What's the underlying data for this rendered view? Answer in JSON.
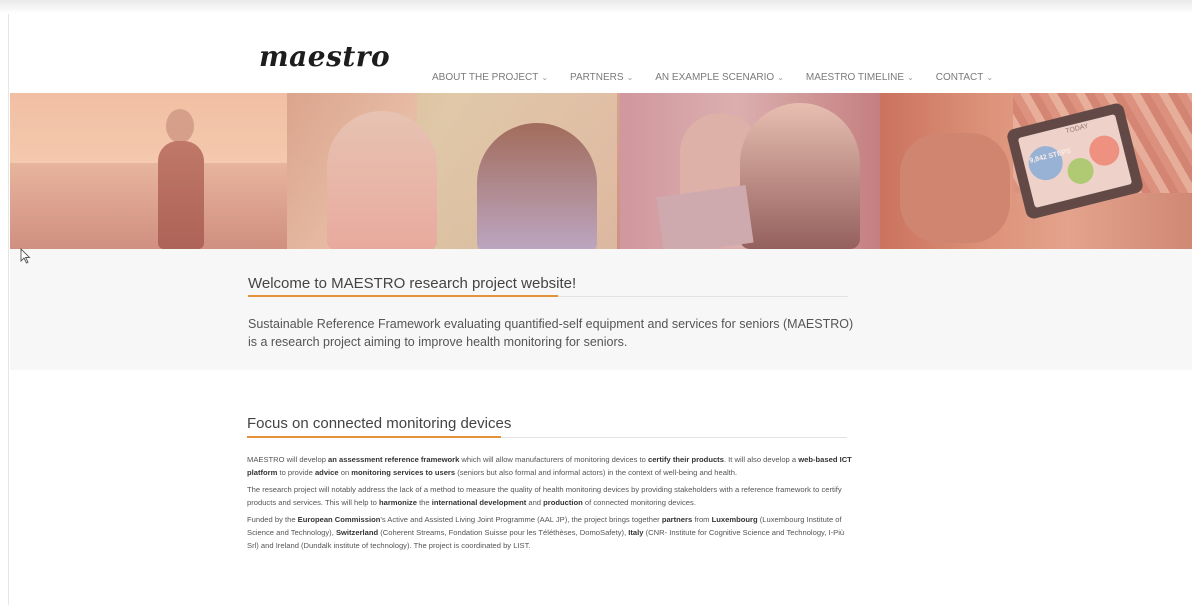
{
  "site": {
    "logo": "maestro"
  },
  "nav": [
    {
      "label": "ABOUT THE PROJECT"
    },
    {
      "label": "PARTNERS"
    },
    {
      "label": "AN EXAMPLE SCENARIO"
    },
    {
      "label": "MAESTRO TIMELINE"
    },
    {
      "label": "CONTACT"
    }
  ],
  "banner": {
    "tablet_today": "TODAY",
    "tablet_steps": "9,842 STEPS"
  },
  "welcome": {
    "title": "Welcome to MAESTRO research project website!",
    "text": "Sustainable Reference Framework evaluating quantified-self equipment and services for seniors (MAESTRO) is a research project aiming to improve health monitoring for seniors."
  },
  "focus": {
    "title": "Focus on connected monitoring devices",
    "p1": [
      {
        "t": "MAESTRO will develop ",
        "b": false
      },
      {
        "t": "an assessment reference framework",
        "b": true
      },
      {
        "t": " which will allow manufacturers of monitoring devices to ",
        "b": false
      },
      {
        "t": "certify their products",
        "b": true
      },
      {
        "t": ". It will also develop a ",
        "b": false
      },
      {
        "t": "web-based ICT platform",
        "b": true
      },
      {
        "t": " to provide ",
        "b": false
      },
      {
        "t": "advice",
        "b": true
      },
      {
        "t": " on ",
        "b": false
      },
      {
        "t": "monitoring services to users",
        "b": true
      },
      {
        "t": " (seniors but also formal and informal actors) in the context of well-being and health.",
        "b": false
      }
    ],
    "p2": [
      {
        "t": "The research project will notably address the lack of a method to measure the quality of health monitoring devices by providing stakeholders with a reference framework to certify products and services. This will help to ",
        "b": false
      },
      {
        "t": "harmonize",
        "b": true
      },
      {
        "t": " the ",
        "b": false
      },
      {
        "t": "international development",
        "b": true
      },
      {
        "t": " and ",
        "b": false
      },
      {
        "t": "production",
        "b": true
      },
      {
        "t": " of connected monitoring devices.",
        "b": false
      }
    ],
    "p3": [
      {
        "t": "Funded by the ",
        "b": false
      },
      {
        "t": "European Commission",
        "b": true
      },
      {
        "t": "'s Active and Assisted Living Joint Programme (AAL JP), the project brings together ",
        "b": false
      },
      {
        "t": "partners",
        "b": true
      },
      {
        "t": " from ",
        "b": false
      },
      {
        "t": "Luxembourg",
        "b": true
      },
      {
        "t": " (Luxembourg Institute of Science and Technology), ",
        "b": false
      },
      {
        "t": "Switzerland",
        "b": true
      },
      {
        "t": " (Coherent Streams, Fondation Suisse pour les Téléthèses, DomoSafety), ",
        "b": false
      },
      {
        "t": "Italy",
        "b": true
      },
      {
        "t": " (CNR- Institute for Cognitive Science and Technology, I-Più Srl) and Ireland (Dundalk institute of technology). The project is coordinated by LIST.",
        "b": false
      }
    ]
  }
}
